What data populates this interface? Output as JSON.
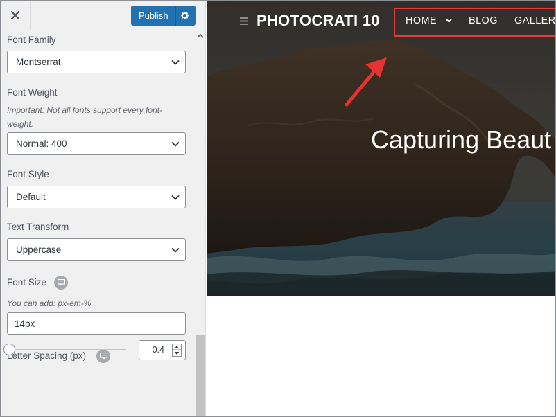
{
  "panel": {
    "close_icon": "close-icon",
    "publish_label": "Publish",
    "settings_icon": "gear-icon",
    "fields": {
      "font_family": {
        "label": "Font Family",
        "value": "Montserrat"
      },
      "font_weight": {
        "label": "Font Weight",
        "description": "Important: Not all fonts support every font-weight.",
        "value": "Normal: 400"
      },
      "font_style": {
        "label": "Font Style",
        "value": "Default"
      },
      "text_transform": {
        "label": "Text Transform",
        "value": "Uppercase"
      },
      "font_size": {
        "label": "Font Size",
        "description": "You can add: px-em-%",
        "value": "14px",
        "device_icon": "desktop-icon"
      },
      "letter_spacing": {
        "label": "Letter Spacing (px)",
        "value": "0.4",
        "slider_fraction": 0.0,
        "device_icon": "desktop-icon"
      }
    }
  },
  "preview": {
    "site_title": "PHOTOCRATI 10",
    "nav": [
      {
        "label": "HOME",
        "has_dropdown": true
      },
      {
        "label": "BLOG",
        "has_dropdown": false
      },
      {
        "label": "GALLER",
        "has_dropdown": false
      }
    ],
    "hero_heading": "Capturing Beaut",
    "highlight_color": "#e23b3b"
  },
  "colors": {
    "accent": "#2271b1",
    "panel_bg": "#f0f0f1",
    "annotation": "#e23b3b"
  }
}
